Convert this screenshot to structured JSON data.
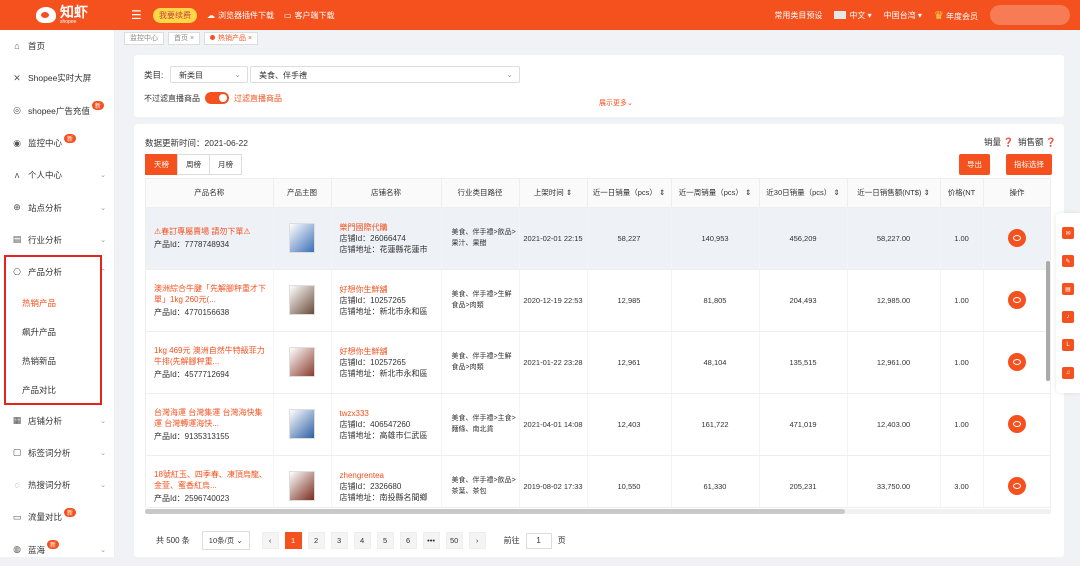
{
  "header": {
    "logo": "知虾",
    "logo_sub": "shopee",
    "badge": "我要续费",
    "links": [
      "浏览器插件下载",
      "客户端下载"
    ],
    "right": [
      "常用类目预设",
      "中文",
      "中国台湾",
      "年度会员"
    ]
  },
  "sidebar": {
    "items": [
      {
        "label": "首页",
        "icon": "home-icon"
      },
      {
        "label": "Shopee实时大屏",
        "icon": "screen-icon"
      },
      {
        "label": "shopee广告充值",
        "icon": "ad-icon",
        "badge": "新"
      },
      {
        "label": "监控中心",
        "icon": "monitor-icon",
        "badge": "新"
      },
      {
        "label": "个人中心",
        "icon": "person-icon"
      },
      {
        "label": "站点分析",
        "icon": "globe-icon"
      },
      {
        "label": "行业分析",
        "icon": "industry-icon"
      },
      {
        "label": "产品分析",
        "icon": "product-icon"
      }
    ],
    "sub_items": [
      "热销产品",
      "飙升产品",
      "热销新品",
      "产品对比"
    ],
    "items2": [
      {
        "label": "店铺分析",
        "icon": "shop-icon"
      },
      {
        "label": "标签词分析",
        "icon": "tag-icon"
      },
      {
        "label": "热搜词分析",
        "icon": "fire-icon"
      },
      {
        "label": "流量对比",
        "icon": "traffic-icon",
        "badge": "新"
      },
      {
        "label": "蓝海",
        "icon": "ocean-icon",
        "badge": "新"
      }
    ]
  },
  "breadcrumb": [
    "监控中心",
    "首页",
    "热销产品"
  ],
  "filter": {
    "category_label": "类目:",
    "category_select": "新类目",
    "category_value": "美食、伴手禮",
    "toggle_off_label": "不过滤直播商品",
    "toggle_on_label": "过滤直播商品",
    "more": "展示更多"
  },
  "panel": {
    "update_time": "数据更新时间：2021-06-22",
    "tabs": [
      "天榜",
      "周榜",
      "月榜"
    ],
    "metric1": "销量",
    "metric2": "销售额",
    "export": "导出",
    "indicator": "指标选择"
  },
  "table": {
    "headers": [
      "产品名称",
      "产品主图",
      "店铺名称",
      "行业类目路径",
      "上架时间",
      "近一日销量（pcs）",
      "近一周销量（pcs）",
      "近30日销量（pcs）",
      "近一日销售额(NT$)",
      "价格(NT",
      "操作"
    ],
    "rows": [
      {
        "name": "⚠春訂專屬賣場 請勿下單⚠",
        "id": "产品Id：7778748934",
        "shop": "樂門國際代購",
        "shop_id": "店铺Id：26066474",
        "shop_addr": "店铺地址：花蓮縣花蓮市",
        "cat": "美食、伴手禮>飲品>果汁、果醋",
        "date": "2021-02-01 22:15",
        "d1": "58,227",
        "w1": "140,953",
        "m30": "456,209",
        "rev": "58,227.00",
        "price": "1.00"
      },
      {
        "name": "澳洲綜合牛腱「先解腳秤重才下單」1kg 260元(...",
        "id": "产品Id：4770156638",
        "shop": "好想你生鮮舖",
        "shop_id": "店铺Id：10257265",
        "shop_addr": "店铺地址：新北市永和區",
        "cat": "美食、伴手禮>生鮮食品>肉類",
        "date": "2020-12-19 22:53",
        "d1": "12,985",
        "w1": "81,805",
        "m30": "204,493",
        "rev": "12,985.00",
        "price": "1.00"
      },
      {
        "name": "1kg 469元 澳洲自然牛特級菲力牛排(先解腳秤重...",
        "id": "产品Id：4577712694",
        "shop": "好想你生鮮舖",
        "shop_id": "店铺Id：10257265",
        "shop_addr": "店铺地址：新北市永和區",
        "cat": "美食、伴手禮>生鮮食品>肉類",
        "date": "2021-01-22 23:28",
        "d1": "12,961",
        "w1": "48,104",
        "m30": "135,515",
        "rev": "12,961.00",
        "price": "1.00"
      },
      {
        "name": "台灣海運 台灣集運 台灣海快集運 台灣轉運海快...",
        "id": "产品Id：9135313155",
        "shop": "twzx333",
        "shop_id": "店铺Id：406547260",
        "shop_addr": "店铺地址：高雄市仁武區",
        "cat": "美食、伴手禮>主食>麵條、南北貨",
        "date": "2021-04-01 14:08",
        "d1": "12,403",
        "w1": "161,722",
        "m30": "471,019",
        "rev": "12,403.00",
        "price": "1.00"
      },
      {
        "name": "18號紅玉、四季春、凍頂烏龍、金萱、蜜香紅烏...",
        "id": "产品Id：2596740023",
        "shop": "zhengrentea",
        "shop_id": "店铺Id：2326680",
        "shop_addr": "店铺地址：南投縣名間鄉",
        "cat": "美食、伴手禮>飲品>茶葉、茶包",
        "date": "2019-08-02 17:33",
        "d1": "10,550",
        "w1": "61,330",
        "m30": "205,231",
        "rev": "33,750.00",
        "price": "3.00"
      }
    ]
  },
  "pager": {
    "total": "共 500 条",
    "size": "10条/页",
    "pages": [
      "1",
      "2",
      "3",
      "4",
      "5",
      "6",
      "•••",
      "50"
    ],
    "goto": "前往",
    "goto_val": "1",
    "page_unit": "页"
  },
  "colors": {
    "brand": "#f4511e",
    "highlight_row": "#eef1f6",
    "frame": "#e5241d"
  }
}
